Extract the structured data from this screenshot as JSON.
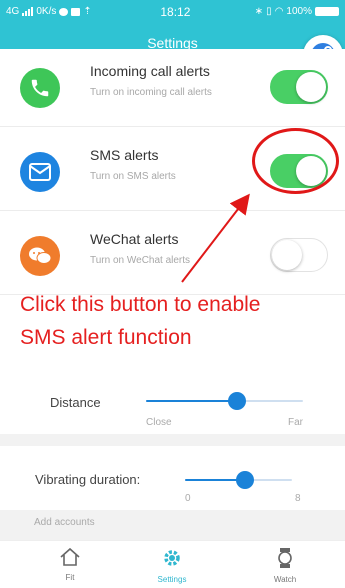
{
  "status_bar": {
    "network": "4G",
    "speed": "0K/s",
    "time": "18:12",
    "battery": "100%"
  },
  "header": {
    "title": "Settings"
  },
  "alerts": [
    {
      "title": "Incoming call alerts",
      "subtitle": "Turn on incoming call alerts",
      "enabled": true,
      "icon": "phone-icon",
      "icon_color": "#3ec658"
    },
    {
      "title": "SMS alerts",
      "subtitle": "Turn on SMS alerts",
      "enabled": true,
      "icon": "envelope-icon",
      "icon_color": "#1e84e0"
    },
    {
      "title": "WeChat alerts",
      "subtitle": "Turn on WeChat alerts",
      "enabled": false,
      "icon": "wechat-icon",
      "icon_color": "#f07c2c"
    }
  ],
  "annotation": {
    "line1": "Click this button to enable",
    "line2": "SMS alert function",
    "color": "#e52020"
  },
  "distance": {
    "label": "Distance",
    "min_label": "Close",
    "max_label": "Far",
    "value_fraction": 0.58
  },
  "vibration": {
    "label": "Vibrating duration:",
    "min_label": "0",
    "max_label": "8",
    "value_fraction": 0.56
  },
  "accounts_label": "Add accounts",
  "tabs": [
    {
      "label": "Fit",
      "icon": "home-icon",
      "active": false
    },
    {
      "label": "Settings",
      "icon": "gear-icon",
      "active": true
    },
    {
      "label": "Watch",
      "icon": "watch-icon",
      "active": false
    }
  ],
  "colors": {
    "accent": "#2fc3d3",
    "toggle_on": "#49cf65",
    "slider_thumb": "#1a82d8",
    "annotation": "#e52020"
  }
}
